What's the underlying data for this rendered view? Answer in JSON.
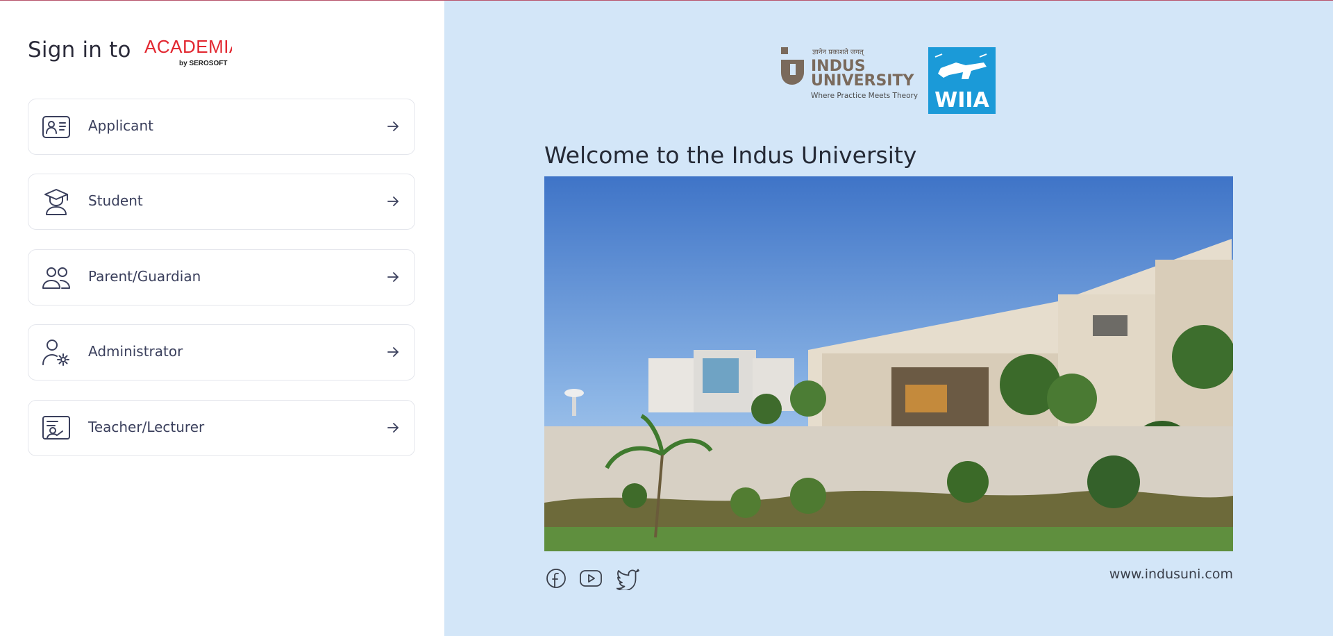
{
  "signin": {
    "title": "Sign in to",
    "brand_name": "ACADEMIA",
    "brand_by": "by SEROSOFT",
    "brand_color": "#e2262f"
  },
  "roles": [
    {
      "label": "Applicant",
      "icon": "id-card-icon"
    },
    {
      "label": "Student",
      "icon": "graduate-icon"
    },
    {
      "label": "Parent/Guardian",
      "icon": "users-icon"
    },
    {
      "label": "Administrator",
      "icon": "user-gear-icon"
    },
    {
      "label": "Teacher/Lecturer",
      "icon": "teacher-board-icon"
    }
  ],
  "arrow_icon": "arrow-right-icon",
  "right": {
    "background": "#d3e6f8",
    "indus": {
      "tagline_top": "ज्ञानेन प्रकाशते जगत्",
      "name_line1": "INDUS",
      "name_line2": "UNIVERSITY",
      "slogan": "Where Practice Meets Theory"
    },
    "wiia": {
      "text": "WIIA",
      "color": "#1b9ad8"
    },
    "welcome": "Welcome to the Indus University",
    "website": "www.indusuni.com",
    "social": [
      "facebook-icon",
      "youtube-icon",
      "twitter-icon"
    ]
  }
}
